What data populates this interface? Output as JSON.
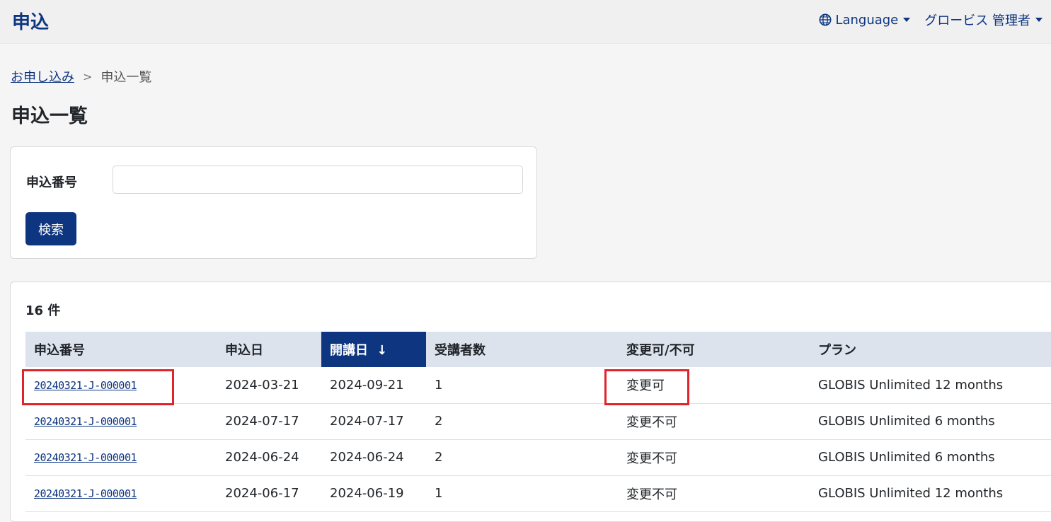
{
  "header": {
    "brand": "申込",
    "language_label": "Language",
    "user_label": "グロービス 管理者"
  },
  "breadcrumb": {
    "parent": "お申し込み",
    "separator": ">",
    "current": "申込一覧"
  },
  "page_title": "申込一覧",
  "search": {
    "label": "申込番号",
    "value": "",
    "placeholder": "",
    "button_label": "検索"
  },
  "results": {
    "count_label": "16 件",
    "columns": [
      "申込番号",
      "申込日",
      "開講日",
      "受講者数",
      "変更可/不可",
      "プラン"
    ],
    "sort_indicator": "↓",
    "rows": [
      {
        "id": "20240321-J-000001",
        "applied": "2024-03-21",
        "start": "2024-09-21",
        "attendees": "1",
        "changeable": "変更可",
        "plan": "GLOBIS Unlimited 12 months"
      },
      {
        "id": "20240321-J-000001",
        "applied": "2024-07-17",
        "start": "2024-07-17",
        "attendees": "2",
        "changeable": "変更不可",
        "plan": "GLOBIS Unlimited 6 months"
      },
      {
        "id": "20240321-J-000001",
        "applied": "2024-06-24",
        "start": "2024-06-24",
        "attendees": "2",
        "changeable": "変更不可",
        "plan": "GLOBIS Unlimited 6 months"
      },
      {
        "id": "20240321-J-000001",
        "applied": "2024-06-17",
        "start": "2024-06-19",
        "attendees": "1",
        "changeable": "変更不可",
        "plan": "GLOBIS Unlimited 12 months"
      }
    ]
  },
  "colors": {
    "primary": "#0d3580",
    "header_row": "#dde3ec",
    "highlight": "#e0242c"
  },
  "icons": {
    "language": "globe-icon",
    "dropdown": "caret-down-icon",
    "sort": "arrow-down-icon"
  }
}
